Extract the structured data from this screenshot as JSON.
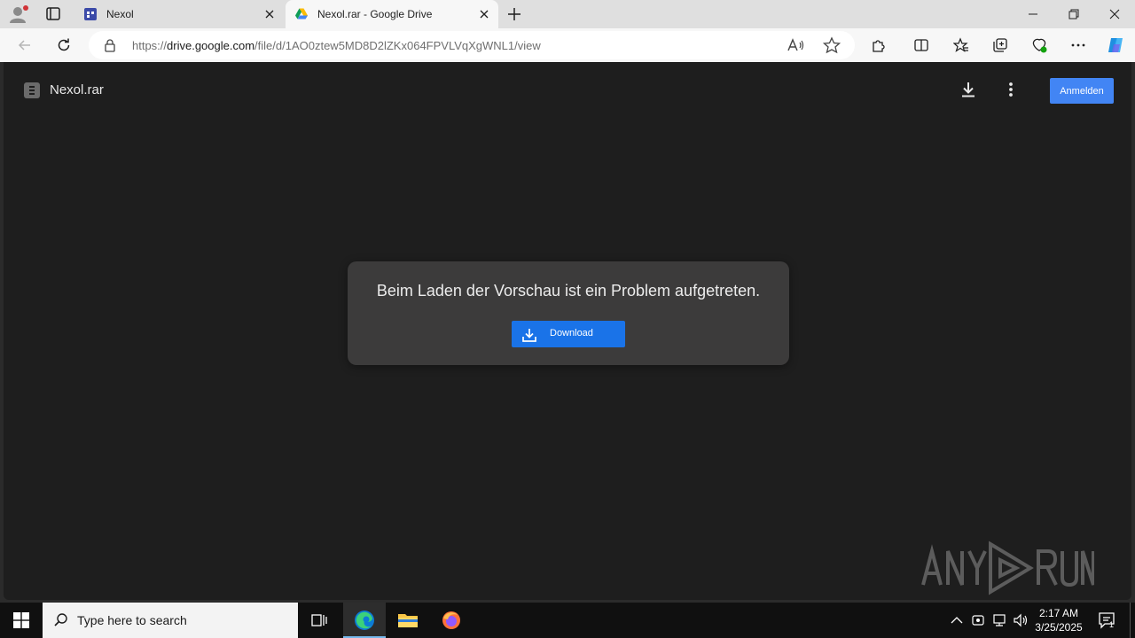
{
  "browser": {
    "tabs": [
      {
        "title": "Nexol",
        "favicon": "calendar-app-icon",
        "active": false
      },
      {
        "title": "Nexol.rar - Google Drive",
        "favicon": "google-drive-icon",
        "active": true
      }
    ],
    "url": {
      "scheme": "https://",
      "host": "drive.google.com",
      "path": "/file/d/1AO0ztew5MD8D2lZKx064FPVLVqXgWNL1/view"
    },
    "window_controls": [
      "minimize-icon",
      "restore-icon",
      "close-icon"
    ]
  },
  "viewer": {
    "file_name": "Nexol.rar",
    "signin_label": "Anmelden",
    "error": {
      "message": "Beim Laden der Vorschau ist ein Problem aufgetreten.",
      "button_label": "Download"
    },
    "watermark": "ANY RUN"
  },
  "taskbar": {
    "search_placeholder": "Type here to search",
    "apps": [
      "task-view-icon",
      "edge-icon",
      "file-explorer-icon",
      "firefox-icon"
    ],
    "clock": {
      "time": "2:17 AM",
      "date": "3/25/2025"
    },
    "notification_count": "1"
  },
  "colors": {
    "viewer_bg": "#1e1e1e",
    "dialog_bg": "#3c3b3b",
    "accent_blue": "#1a73e8",
    "signin_blue": "#4285f4"
  }
}
